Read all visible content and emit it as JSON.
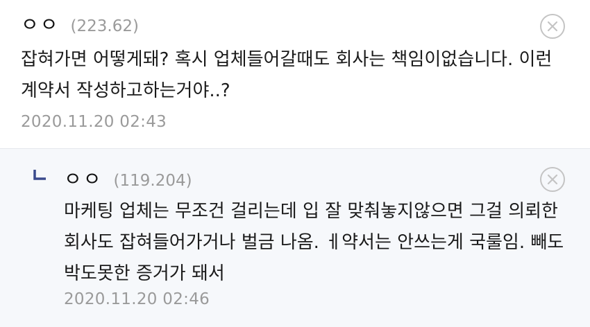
{
  "comments": [
    {
      "nick": "ㅇㅇ",
      "ip": "(223.62)",
      "text": "잡혀가면 어떻게돼? 혹시 업체들어갈때도 회사는 책임이없습니다. 이런 계약서 작성하고하는거야..?",
      "date": "2020.11.20 02:43",
      "delete_icon": "close-circle-icon"
    },
    {
      "nick": "ㅇㅇ",
      "ip": "(119.204)",
      "text": "마케팅 업체는 무조건 걸리는데 입 잘 맞춰놓지않으면 그걸 의뢰한 회사도 잡혀들어가거나 벌금 나옴. ㅔ약서는 안쓰는게 국룰임. 빼도박도못한 증거가 돼서",
      "date": "2020.11.20 02:46",
      "reply_icon": "reply-arrow-icon",
      "delete_icon": "close-circle-icon"
    }
  ],
  "colors": {
    "reply_background": "#f6f8fb",
    "reply_mark": "#3a4a8c",
    "meta_text": "#9a9a9a"
  }
}
